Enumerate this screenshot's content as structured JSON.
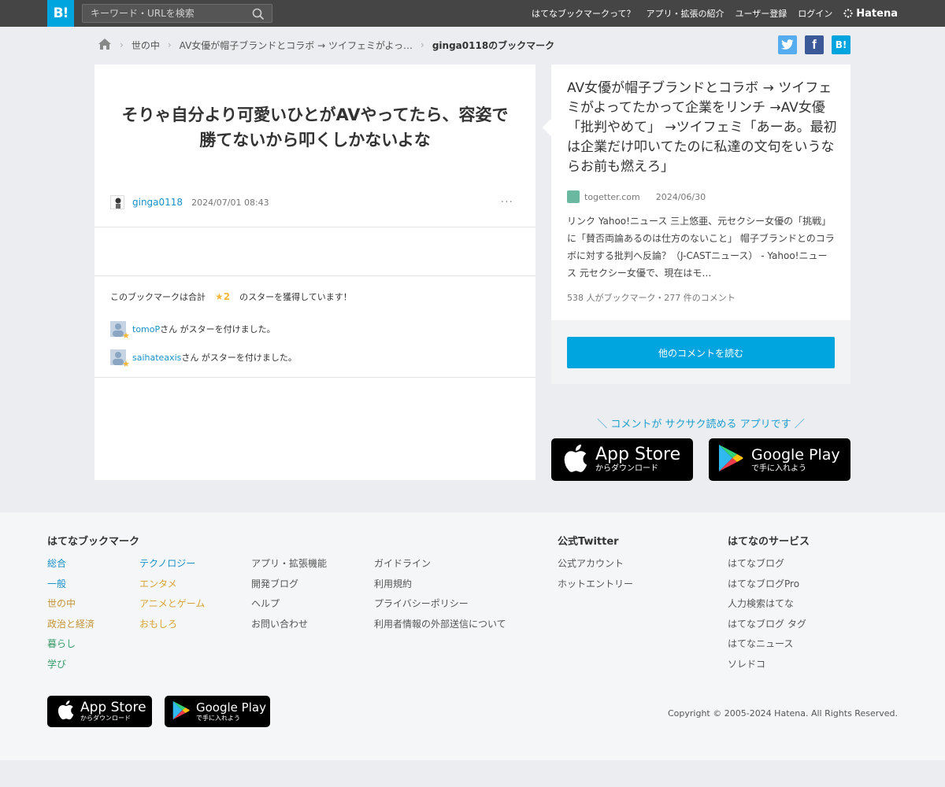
{
  "header": {
    "logo_text": "B!",
    "search_placeholder": "キーワード・URLを検索",
    "nav": [
      "はてなブックマークって？",
      "アプリ・拡張の紹介",
      "ユーザー登録",
      "ログイン"
    ],
    "brand": "Hatena"
  },
  "breadcrumb": {
    "items": [
      "世の中",
      "AV女優が帽子ブランドとコラボ → ツイフェミがよっ…",
      "ginga0118のブックマーク"
    ]
  },
  "share": {
    "twitter": "twitter-share",
    "facebook": "f",
    "hatena": "B!"
  },
  "bookmark": {
    "comment": "そりゃ自分より可愛いひとがAVやってたら、容姿で勝てないから叩くしかないよな",
    "user": "ginga0118",
    "datetime": "2024/07/01 08:43",
    "more": "···",
    "star_summary_prefix": "このブックマークは合計",
    "star_count": "★2",
    "star_summary_suffix": "のスターを獲得しています！",
    "star_users": [
      {
        "name": "tomoP",
        "suffix": "さん がスターを付けました。"
      },
      {
        "name": "saihateaxis",
        "suffix": "さん がスターを付けました。"
      }
    ]
  },
  "entry": {
    "title": "AV女優が帽子ブランドとコラボ → ツイフェミがよってたかって企業をリンチ →AV女優「批判やめて」 →ツイフェミ「あーあ。最初は企業だけ叩いてたのに私達の文句をいうならお前も燃えろ」",
    "source": "togetter.com",
    "date": "2024/06/30",
    "description": "リンク Yahoo!ニュース 三上悠亜、元セクシー女優の「挑戦」に「賛否両論あるのは仕方のないこと」 帽子ブランドとのコラボに対する批判へ反論？（J-CASTニュース） - Yahoo!ニュース 元セクシー女優で、現在はモ…",
    "stats": "538 人がブックマーク・277 件のコメント",
    "read_button": "他のコメントを読む"
  },
  "app_promo": {
    "tagline": "＼ コメントが サクサク読める アプリです ／",
    "appstore_big": "App Store",
    "appstore_small": "からダウンロード",
    "googleplay_big": "Google Play",
    "googleplay_small": "で手に入れよう"
  },
  "footer": {
    "bookmark_heading": "はてなブックマーク",
    "categories_a": [
      "総合",
      "一般",
      "世の中",
      "政治と経済",
      "暮らし",
      "学び"
    ],
    "categories_b": [
      "テクノロジー",
      "エンタメ",
      "アニメとゲーム",
      "おもしろ"
    ],
    "links_a": [
      "アプリ・拡張機能",
      "開発ブログ",
      "ヘルプ",
      "お問い合わせ"
    ],
    "links_b": [
      "ガイドライン",
      "利用規約",
      "プライバシーポリシー",
      "利用者情報の外部送信について"
    ],
    "twitter_heading": "公式Twitter",
    "twitter_links": [
      "公式アカウント",
      "ホットエントリー"
    ],
    "services_heading": "はてなのサービス",
    "services": [
      "はてなブログ",
      "はてなブログPro",
      "人力検索はてな",
      "はてなブログ タグ",
      "はてなニュース",
      "ソレドコ"
    ],
    "appstore_big": "App Store",
    "appstore_small": "からダウンロード",
    "googleplay_big": "Google Play",
    "googleplay_small": "で手に入れよう",
    "copyright": "Copyright © 2005-2024 Hatena. All Rights Reserved."
  },
  "colors": {
    "brand_blue": "#00a4de",
    "topbar": "#454545",
    "link_blue": "#1690c9",
    "star": "#f2b83b"
  }
}
